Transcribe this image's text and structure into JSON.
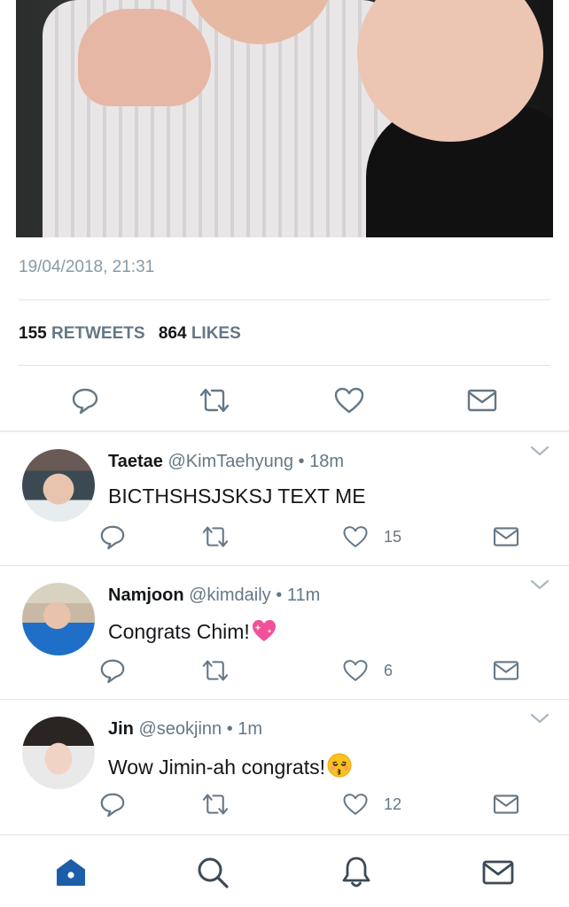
{
  "tweet": {
    "timestamp": "19/04/2018, 21:31",
    "retweets": "155",
    "retweets_label": "RETWEETS",
    "likes": "864",
    "likes_label": "LIKES"
  },
  "replies": [
    {
      "name": "Taetae",
      "handle": "@KimTaehyung",
      "time": "18m",
      "text": "BICTHSHSJSKSJ TEXT ME",
      "emoji": "",
      "likes": "15"
    },
    {
      "name": "Namjoon",
      "handle": "@kimdaily",
      "time": "11m",
      "text": "Congrats Chim!",
      "emoji": "sparkling-heart",
      "likes": "6"
    },
    {
      "name": "Jin",
      "handle": "@seokjinn",
      "time": "1m",
      "text": "Wow Jimin-ah congrats!",
      "emoji": "kissing-face",
      "likes": "12"
    }
  ],
  "separator": "•",
  "icons": {
    "reply": "reply-icon",
    "retweet": "retweet-icon",
    "like": "heart-icon",
    "dm": "envelope-icon",
    "more": "chevron-down-icon",
    "home": "home-icon",
    "search": "search-icon",
    "notifications": "bell-icon",
    "messages": "envelope-icon"
  },
  "colors": {
    "accent": "#1da1f2",
    "home_active": "#1c5ea8",
    "icon": "#657786",
    "nav_icon": "#3c4a58",
    "muted_text": "#8899a6"
  }
}
